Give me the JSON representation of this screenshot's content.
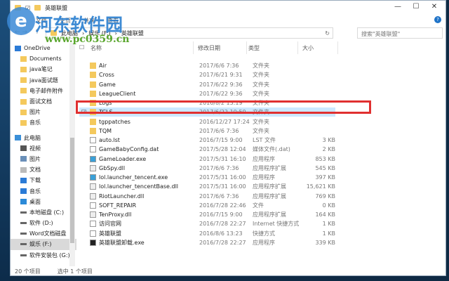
{
  "window": {
    "title": "英雄联盟",
    "minimize": "—",
    "maximize": "☐",
    "close": "✕",
    "help": "?"
  },
  "ribbon": [
    "文件",
    "主页",
    "共享",
    "查看"
  ],
  "address": {
    "parts": [
      "此电脑",
      "娱乐 (F:)",
      "英雄联盟"
    ],
    "refresh": "↻"
  },
  "search": {
    "placeholder": "搜索\"英雄联盟\""
  },
  "sidebar": [
    {
      "label": "OneDrive",
      "icon": "cloud-icon",
      "indent": 0
    },
    {
      "label": "Documents",
      "icon": "folder-icon",
      "indent": 1
    },
    {
      "label": "java笔记",
      "icon": "folder-icon",
      "indent": 1
    },
    {
      "label": "java面试题",
      "icon": "folder-icon",
      "indent": 1
    },
    {
      "label": "电子邮件附件",
      "icon": "folder-icon",
      "indent": 1
    },
    {
      "label": "面试文档",
      "icon": "folder-icon",
      "indent": 1
    },
    {
      "label": "图片",
      "icon": "folder-icon",
      "indent": 1
    },
    {
      "label": "音乐",
      "icon": "folder-icon",
      "indent": 1
    },
    {
      "label": "此电脑",
      "icon": "computer-icon",
      "indent": 0
    },
    {
      "label": "视频",
      "icon": "video-icon",
      "indent": 1
    },
    {
      "label": "图片",
      "icon": "pictures-icon",
      "indent": 1
    },
    {
      "label": "文档",
      "icon": "document-icon",
      "indent": 1
    },
    {
      "label": "下载",
      "icon": "download-icon",
      "indent": 1
    },
    {
      "label": "音乐",
      "icon": "music-icon",
      "indent": 1
    },
    {
      "label": "桌面",
      "icon": "desktop-icon",
      "indent": 1
    },
    {
      "label": "本地磁盘 (C:)",
      "icon": "drive-icon",
      "indent": 1
    },
    {
      "label": "软件 (D:)",
      "icon": "drive-icon",
      "indent": 1
    },
    {
      "label": "Word文档磁盘",
      "icon": "drive-icon",
      "indent": 1
    },
    {
      "label": "娱乐 (F:)",
      "icon": "drive-icon",
      "indent": 1,
      "selected": true
    },
    {
      "label": "软件安装包 (G:)",
      "icon": "drive-icon",
      "indent": 1
    }
  ],
  "columns": {
    "name": "名称",
    "date": "修改日期",
    "type": "类型",
    "size": "大小"
  },
  "files": [
    {
      "name": "Air",
      "date": "2017/6/6 7:36",
      "type": "文件夹",
      "size": "",
      "icon": "folder"
    },
    {
      "name": "Cross",
      "date": "2017/6/21 9:31",
      "type": "文件夹",
      "size": "",
      "icon": "folder"
    },
    {
      "name": "Game",
      "date": "2017/6/22 9:36",
      "type": "文件夹",
      "size": "",
      "icon": "folder"
    },
    {
      "name": "LeagueClient",
      "date": "2017/6/22 9:36",
      "type": "文件夹",
      "size": "",
      "icon": "folder"
    },
    {
      "name": "Logs",
      "date": "2016/8/2 13:19",
      "type": "文件夹",
      "size": "",
      "icon": "folder"
    },
    {
      "name": "TCLS",
      "date": "2017/6/22 10:50",
      "type": "文件夹",
      "size": "",
      "icon": "folder",
      "selected": true
    },
    {
      "name": "tgppatches",
      "date": "2016/12/27 17:24",
      "type": "文件夹",
      "size": "",
      "icon": "folder"
    },
    {
      "name": "TQM",
      "date": "2017/6/6 7:36",
      "type": "文件夹",
      "size": "",
      "icon": "folder"
    },
    {
      "name": "auto.lst",
      "date": "2016/7/15 9:00",
      "type": "LST 文件",
      "size": "3 KB",
      "icon": "file"
    },
    {
      "name": "GameBabyConfig.dat",
      "date": "2017/5/28 12:04",
      "type": "媒体文件(.dat)",
      "size": "2 KB",
      "icon": "media"
    },
    {
      "name": "GameLoader.exe",
      "date": "2017/5/31 16:10",
      "type": "应用程序",
      "size": "853 KB",
      "icon": "exe"
    },
    {
      "name": "GbSpy.dll",
      "date": "2017/6/6 7:36",
      "type": "应用程序扩展",
      "size": "545 KB",
      "icon": "dll"
    },
    {
      "name": "lol.launcher_tencent.exe",
      "date": "2017/5/31 16:00",
      "type": "应用程序",
      "size": "397 KB",
      "icon": "exe"
    },
    {
      "name": "lol.launcher_tencentBase.dll",
      "date": "2017/5/31 16:00",
      "type": "应用程序扩展",
      "size": "15,621 KB",
      "icon": "dll"
    },
    {
      "name": "RiotLauncher.dll",
      "date": "2017/6/6 7:36",
      "type": "应用程序扩展",
      "size": "769 KB",
      "icon": "dll"
    },
    {
      "name": "SOFT_REPAIR",
      "date": "2016/7/28 22:46",
      "type": "文件",
      "size": "0 KB",
      "icon": "file"
    },
    {
      "name": "TenProxy.dll",
      "date": "2016/7/15 9:00",
      "type": "应用程序扩展",
      "size": "164 KB",
      "icon": "dll"
    },
    {
      "name": "访问官网",
      "date": "2016/7/28 22:27",
      "type": "Internet 快捷方式",
      "size": "1 KB",
      "icon": "url"
    },
    {
      "name": "英雄联盟",
      "date": "2016/8/6 13:23",
      "type": "快捷方式",
      "size": "1 KB",
      "icon": "shortcut"
    },
    {
      "name": "英雄联盟卸载.exe",
      "date": "2016/7/28 22:27",
      "type": "应用程序",
      "size": "339 KB",
      "icon": "uninstall"
    }
  ],
  "status": {
    "count": "20 个项目",
    "selected": "选中 1 个项目"
  },
  "watermark": {
    "title": "河东软件园",
    "url": "www.pc0359.cn"
  },
  "colors": {
    "highlight": "#e03030",
    "selection": "#cce8ff",
    "folder": "#f4c95d"
  }
}
